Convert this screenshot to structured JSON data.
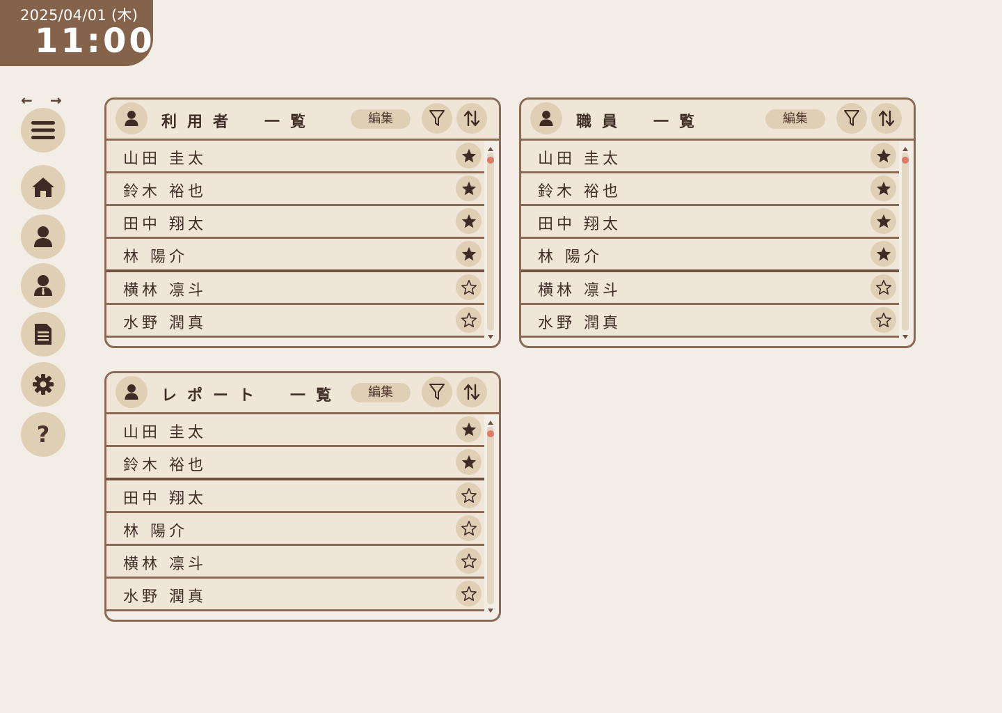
{
  "clock": {
    "date": "2025/04/01 (木)",
    "time": "11:00"
  },
  "nav": {
    "back_label": "←",
    "forward_label": "→",
    "items": [
      "menu-icon",
      "home-icon",
      "user-icon",
      "staff-icon",
      "document-icon",
      "gear-icon",
      "help-icon"
    ],
    "help_label": "?"
  },
  "panels": [
    {
      "title": "利用者　一覧",
      "edit_label": "編集",
      "rows": [
        {
          "name": "山田 圭太",
          "starred": true
        },
        {
          "name": "鈴木 裕也",
          "starred": true
        },
        {
          "name": "田中 翔太",
          "starred": true
        },
        {
          "name": "林 陽介",
          "starred": true
        },
        {
          "name": "横林 凛斗",
          "starred": false
        },
        {
          "name": "水野 潤真",
          "starred": false
        }
      ]
    },
    {
      "title": "職員　一覧",
      "edit_label": "編集",
      "rows": [
        {
          "name": "山田 圭太",
          "starred": true
        },
        {
          "name": "鈴木 裕也",
          "starred": true
        },
        {
          "name": "田中 翔太",
          "starred": true
        },
        {
          "name": "林 陽介",
          "starred": true
        },
        {
          "name": "横林 凛斗",
          "starred": false
        },
        {
          "name": "水野 潤真",
          "starred": false
        }
      ]
    },
    {
      "title": "レポート　一覧",
      "edit_label": "編集",
      "rows": [
        {
          "name": "山田 圭太",
          "starred": true
        },
        {
          "name": "鈴木 裕也",
          "starred": true
        },
        {
          "name": "田中 翔太",
          "starred": false
        },
        {
          "name": "林 陽介",
          "starred": false
        },
        {
          "name": "横林 凛斗",
          "starred": false
        },
        {
          "name": "水野 潤真",
          "starred": false
        }
      ]
    }
  ],
  "colors": {
    "background": "#f2ede5",
    "clock_bg": "#85634a",
    "accent_soft": "#dfcfb5",
    "border": "#8b6a55",
    "scroll_thumb": "#e07a68"
  }
}
